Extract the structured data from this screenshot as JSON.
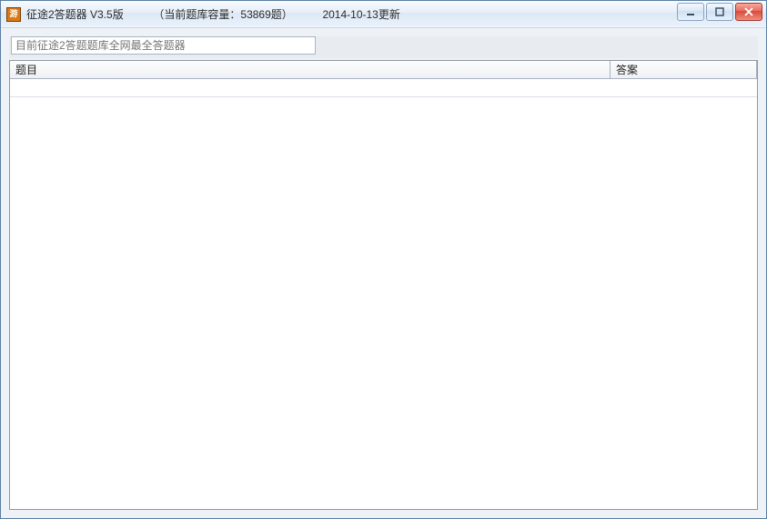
{
  "title": {
    "app_name": "征途2答题器 V3.5版",
    "db_info": "（当前题库容量：53869题）",
    "update_date": "2014-10-13更新"
  },
  "window_controls": {
    "minimize": "minimize",
    "maximize": "maximize",
    "close": "close"
  },
  "search": {
    "placeholder": "目前征途2答题题库全网最全答题器",
    "value": ""
  },
  "columns": {
    "question": "题目",
    "answer": "答案"
  },
  "rows": [
    {
      "question": "",
      "answer": ""
    }
  ]
}
